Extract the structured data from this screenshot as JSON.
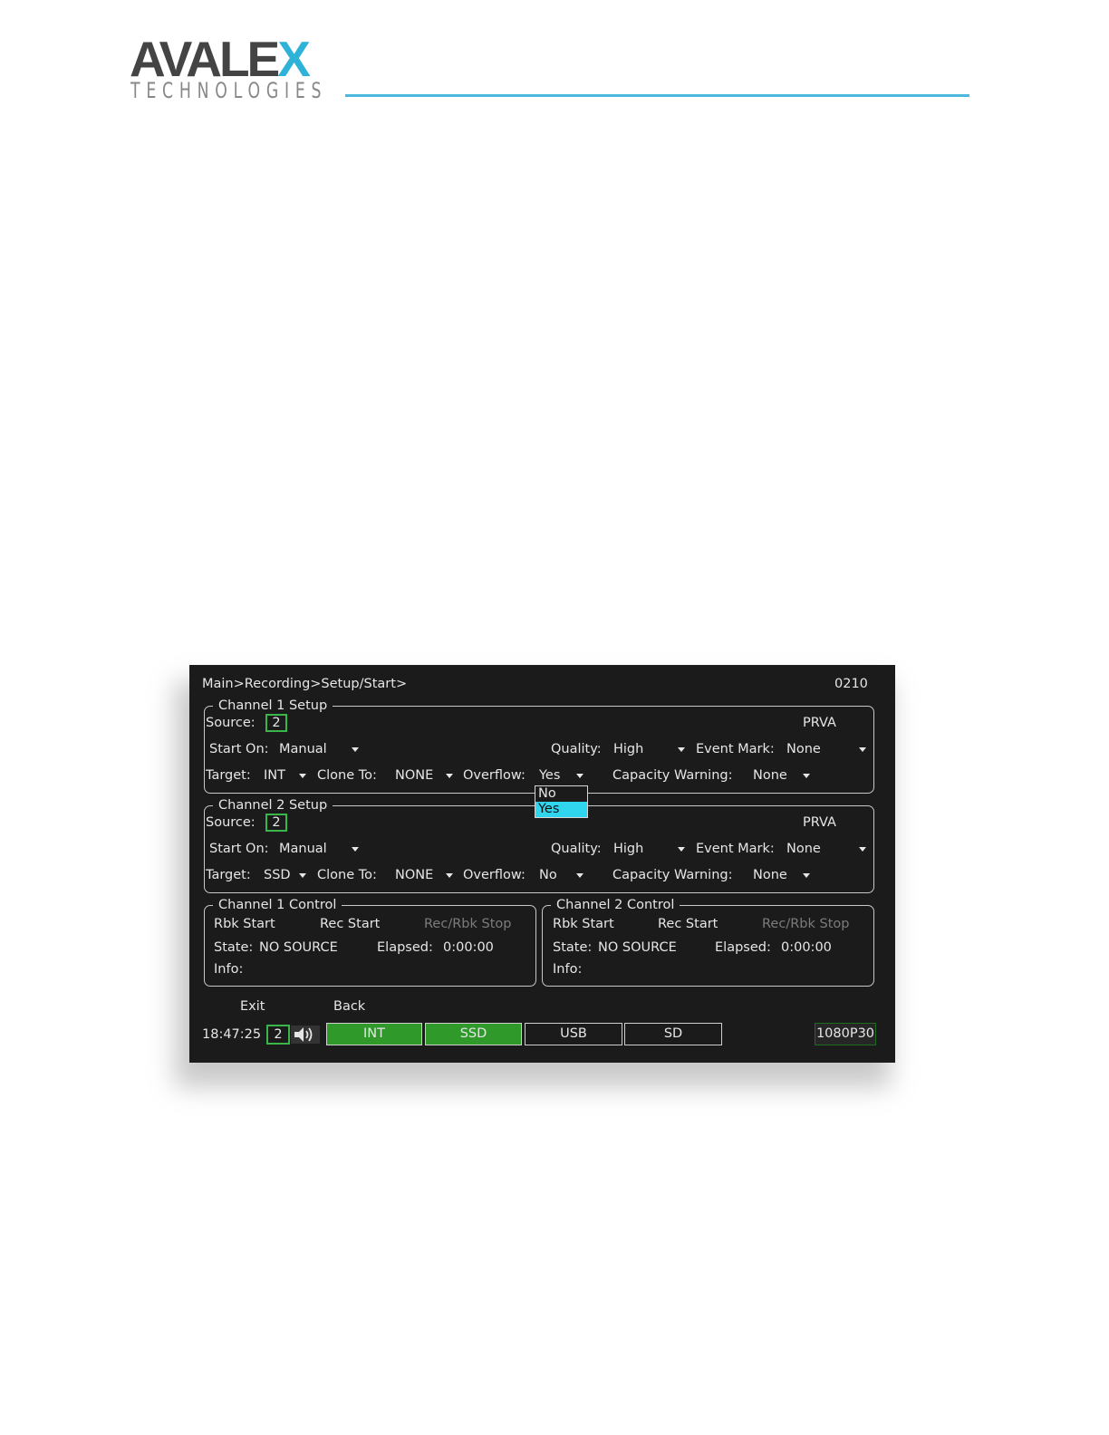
{
  "logo": {
    "brand_prefix": "AVALE",
    "brand_x": "X",
    "tagline": "TECHNOLOGIES"
  },
  "screen": {
    "breadcrumb": "Main>Recording>Setup/Start>",
    "code": "0210",
    "channel1_setup": {
      "title": "Channel 1 Setup",
      "source_label": "Source:",
      "source_value": "2",
      "mode": "PRVA",
      "start_on_label": "Start On:",
      "start_on_value": "Manual",
      "quality_label": "Quality:",
      "quality_value": "High",
      "event_mark_label": "Event Mark:",
      "event_mark_value": "None",
      "target_label": "Target:",
      "target_value": "INT",
      "clone_label": "Clone To:",
      "clone_value": "NONE",
      "overflow_label": "Overflow:",
      "overflow_value": "Yes",
      "capacity_label": "Capacity Warning:",
      "capacity_value": "None"
    },
    "overflow_dropdown": {
      "options": [
        "No",
        "Yes"
      ],
      "selected": "Yes"
    },
    "channel2_setup": {
      "title": "Channel 2 Setup",
      "source_label": "Source:",
      "source_value": "2",
      "mode": "PRVA",
      "start_on_label": "Start On:",
      "start_on_value": "Manual",
      "quality_label": "Quality:",
      "quality_value": "High",
      "event_mark_label": "Event Mark:",
      "event_mark_value": "None",
      "target_label": "Target:",
      "target_value": "SSD",
      "clone_label": "Clone To:",
      "clone_value": "NONE",
      "overflow_label": "Overflow:",
      "overflow_value": "No",
      "capacity_label": "Capacity Warning:",
      "capacity_value": "None"
    },
    "channel1_control": {
      "title": "Channel 1 Control",
      "rbk_start": "Rbk Start",
      "rec_start": "Rec Start",
      "stop": "Rec/Rbk Stop",
      "state_label": "State:",
      "state_value": "NO SOURCE",
      "elapsed_label": "Elapsed:",
      "elapsed_value": "0:00:00",
      "info_label": "Info:"
    },
    "channel2_control": {
      "title": "Channel 2 Control",
      "rbk_start": "Rbk Start",
      "rec_start": "Rec Start",
      "stop": "Rec/Rbk Stop",
      "state_label": "State:",
      "state_value": "NO SOURCE",
      "elapsed_label": "Elapsed:",
      "elapsed_value": "0:00:00",
      "info_label": "Info:"
    },
    "nav": {
      "exit": "Exit",
      "back": "Back"
    },
    "status_bar": {
      "time": "18:47:25",
      "source": "2",
      "speaker_icon": "speaker-icon",
      "targets": [
        {
          "label": "INT",
          "active": true
        },
        {
          "label": "SSD",
          "active": true
        },
        {
          "label": "USB",
          "active": false
        },
        {
          "label": "SD",
          "active": false
        }
      ],
      "resolution": "1080P30"
    },
    "colors": {
      "background": "#1b1b1b",
      "active_green": "#2f9a2a",
      "source_border": "#39b54a",
      "selection": "#2fd6ee",
      "header_rule": "#4bb8de"
    }
  }
}
